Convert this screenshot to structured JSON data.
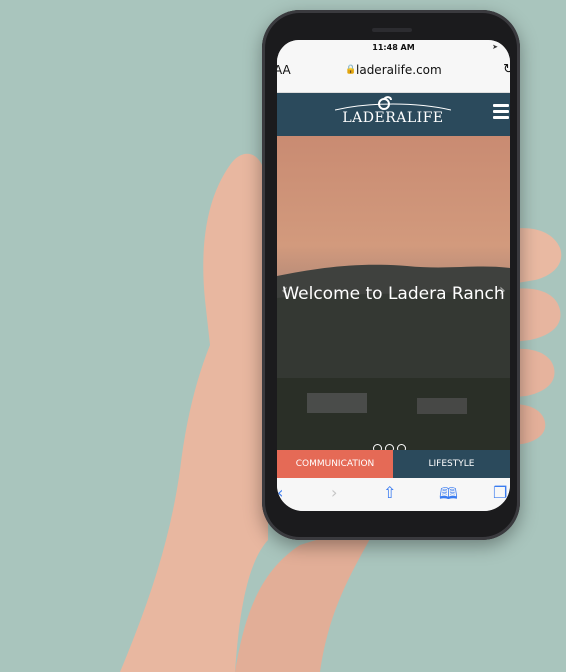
{
  "status_bar": {
    "time": "11:48 AM",
    "location_icon": "location-arrow-icon"
  },
  "browser": {
    "text_size_label": "AA",
    "url": "laderalife.com",
    "lock_icon": "lock-icon",
    "reload_icon": "reload-icon"
  },
  "site": {
    "logo_text": "LADERALIFE",
    "menu_icon": "hamburger-menu-icon",
    "hero_title": "Welcome to Ladera Ranch",
    "tabs": [
      {
        "label": "COMMUNICATION",
        "color": "#e56a56"
      },
      {
        "label": "LIFESTYLE",
        "color": "#2b4a5c"
      }
    ]
  },
  "toolbar": {
    "back_icon": "back-chevron-icon",
    "forward_icon": "forward-chevron-icon",
    "share_icon": "share-icon",
    "bookmarks_icon": "book-icon",
    "tabs_icon": "tabs-icon"
  },
  "colors": {
    "background": "#a9c5bd",
    "nav": "#2b4a5c",
    "accent": "#e56a56",
    "ios_blue": "#3b7cf0"
  }
}
